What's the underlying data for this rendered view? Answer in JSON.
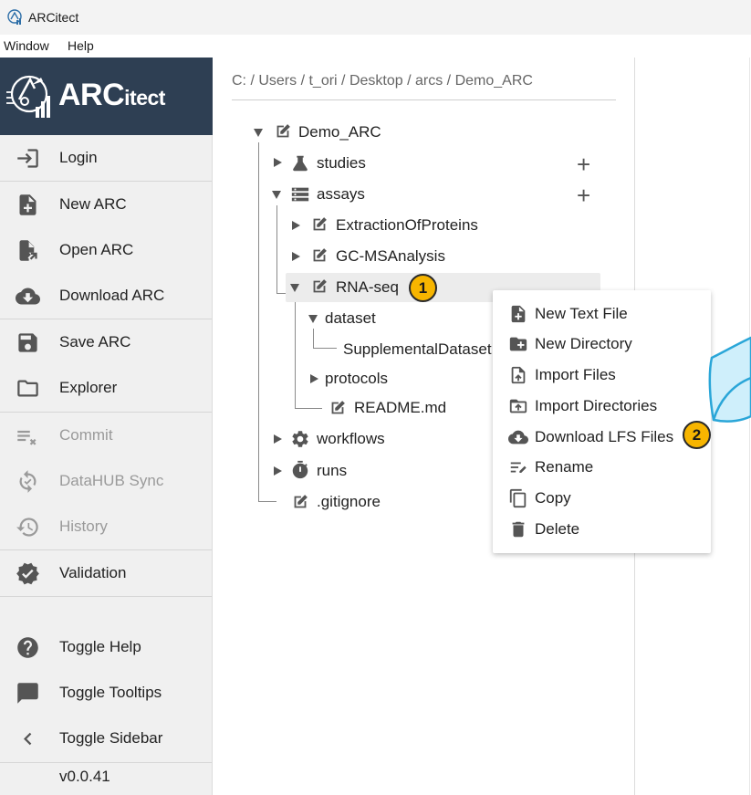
{
  "window": {
    "title": "ARCitect"
  },
  "menubar": {
    "items": [
      "Window",
      "Help"
    ]
  },
  "brand": {
    "title_main": "ARC",
    "title_small": "itect"
  },
  "sidebar": {
    "items": [
      {
        "label": "Login",
        "icon": "login-icon",
        "enabled": true
      },
      {
        "label": "New ARC",
        "icon": "new-file-icon",
        "enabled": true
      },
      {
        "label": "Open ARC",
        "icon": "open-file-icon",
        "enabled": true
      },
      {
        "label": "Download ARC",
        "icon": "cloud-download-icon",
        "enabled": true
      },
      {
        "label": "Save ARC",
        "icon": "save-icon",
        "enabled": true
      },
      {
        "label": "Explorer",
        "icon": "folder-icon",
        "enabled": true
      },
      {
        "label": "Commit",
        "icon": "commit-icon",
        "enabled": false
      },
      {
        "label": "DataHUB Sync",
        "icon": "sync-icon",
        "enabled": false
      },
      {
        "label": "History",
        "icon": "history-icon",
        "enabled": false
      },
      {
        "label": "Validation",
        "icon": "verified-icon",
        "enabled": true
      },
      {
        "label": "Toggle Help",
        "icon": "help-icon",
        "enabled": true
      },
      {
        "label": "Toggle Tooltips",
        "icon": "tooltip-icon",
        "enabled": true
      },
      {
        "label": "Toggle Sidebar",
        "icon": "chevron-left-icon",
        "enabled": true
      }
    ],
    "version": "v0.0.41"
  },
  "breadcrumb": {
    "segments": [
      "C:",
      "Users",
      "t_ori",
      "Desktop",
      "arcs",
      "Demo_ARC"
    ],
    "separator": "/"
  },
  "tree": {
    "root": "Demo_ARC",
    "studies": "studies",
    "assays": "assays",
    "assay_1": "ExtractionOfProteins",
    "assay_2": "GC-MSAnalysis",
    "assay_3": "RNA-seq",
    "dataset": "dataset",
    "dataset_child": "SupplementalDataset",
    "protocols": "protocols",
    "readme": "README.md",
    "workflows": "workflows",
    "runs": "runs",
    "gitignore": ".gitignore",
    "add_symbol": "+"
  },
  "context_menu": {
    "items": [
      {
        "label": "New Text File",
        "icon": "new-text-file-icon"
      },
      {
        "label": "New Directory",
        "icon": "new-folder-icon"
      },
      {
        "label": "Import Files",
        "icon": "import-file-icon"
      },
      {
        "label": "Import Directories",
        "icon": "import-folder-icon"
      },
      {
        "label": "Download LFS Files",
        "icon": "cloud-download-icon"
      },
      {
        "label": "Rename",
        "icon": "rename-icon"
      },
      {
        "label": "Copy",
        "icon": "copy-icon"
      },
      {
        "label": "Delete",
        "icon": "trash-icon"
      }
    ]
  },
  "annotations": {
    "badge_1": "1",
    "badge_2": "2"
  },
  "colors": {
    "brand_bg": "#2e3f53",
    "badge": "#f7b500",
    "sidebar_bg": "#f0f0f0",
    "icon": "#555555",
    "disabled": "#9a9a9a",
    "deco_fill": "#cfeffb",
    "deco_stroke": "#2aa6d8"
  }
}
